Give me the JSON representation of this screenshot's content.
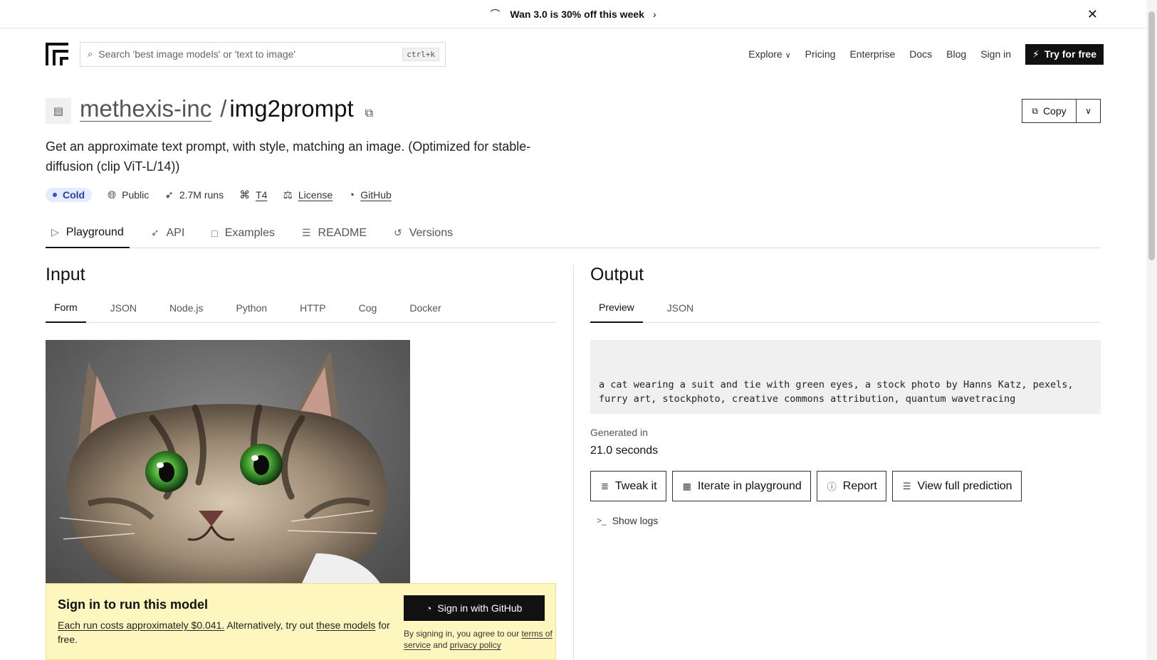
{
  "banner": {
    "text": "Wan 3.0 is 30% off this week",
    "icon": "wan-logo-icon"
  },
  "nav": {
    "search_placeholder": "Search 'best image models' or 'text to image'",
    "search_shortcut": "ctrl+k",
    "links": {
      "explore": "Explore",
      "pricing": "Pricing",
      "enterprise": "Enterprise",
      "docs": "Docs",
      "blog": "Blog",
      "signin": "Sign in"
    },
    "try_label": "Try for free"
  },
  "model": {
    "owner": "methexis-inc",
    "separator": "/",
    "name": "img2prompt",
    "description": "Get an approximate text prompt, with style, matching an image. (Optimized for stable-diffusion (clip ViT-L/14))",
    "copy_label": "Copy"
  },
  "meta": {
    "status": "Cold",
    "visibility": "Public",
    "runs": "2.7M runs",
    "hardware": "T4",
    "license": "License",
    "github": "GitHub"
  },
  "tabs": {
    "playground": "Playground",
    "api": "API",
    "examples": "Examples",
    "readme": "README",
    "versions": "Versions"
  },
  "input": {
    "heading": "Input",
    "tabs": {
      "form": "Form",
      "json": "JSON",
      "node": "Node.js",
      "python": "Python",
      "http": "HTTP",
      "cog": "Cog",
      "docker": "Docker"
    }
  },
  "signin_box": {
    "title": "Sign in to run this model",
    "cost_link": "Each run costs approximately $0.041.",
    "alt_text": " Alternatively, try out ",
    "models_link": "these models",
    "free_text": " for free.",
    "button": "Sign in with GitHub",
    "legal_prefix": "By signing in, you agree to our ",
    "terms_link": "terms of service",
    "and_text": " and ",
    "privacy_link": "privacy policy"
  },
  "output": {
    "heading": "Output",
    "tabs": {
      "preview": "Preview",
      "json": "JSON"
    },
    "text": "a cat wearing a suit and tie with green eyes, a stock photo by Hanns Katz, pexels, furry art, stockphoto, creative commons attribution, quantum wavetracing",
    "generated_label": "Generated in",
    "generated_value": "21.0 seconds",
    "actions": {
      "tweak": "Tweak it",
      "iterate": "Iterate in playground",
      "report": "Report",
      "full": "View full prediction"
    },
    "show_logs": "Show logs"
  }
}
